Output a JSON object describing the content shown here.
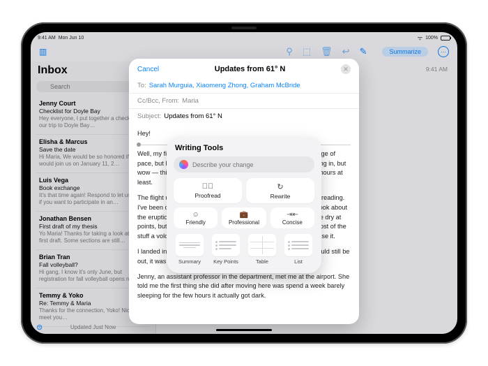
{
  "status": {
    "time": "9:41 AM",
    "date": "Mon Jun 10",
    "battery": "100%"
  },
  "toolbar": {
    "summarize": "Summarize"
  },
  "sidebar": {
    "title": "Inbox",
    "search_placeholder": "Search",
    "updated": "Updated Just Now",
    "items": [
      {
        "from": "Jenny Court",
        "subject": "Checklist for Doyle Bay",
        "preview": "Hey everyone, I put together a checklist for our trip to Doyle Bay…"
      },
      {
        "from": "Elisha & Marcus",
        "subject": "Save the date",
        "preview": "Hi Maria, We would be so honored if you would join us on January 11, 2…"
      },
      {
        "from": "Luis Vega",
        "subject": "Book exchange",
        "preview": "It's that time again! Respond to let us know if you want to participate in an…"
      },
      {
        "from": "Jonathan Bensen",
        "subject": "First draft of my thesis",
        "preview": "Yo Maria! Thanks for taking a look at my first draft. Some sections are still…"
      },
      {
        "from": "Brian Tran",
        "subject": "Fall volleyball?",
        "preview": "Hi gang, I know it's only June, but registration for fall volleyball opens ne…"
      },
      {
        "from": "Temmy & Yoko",
        "subject": "Re: Temmy & Maria",
        "preview": "Thanks for the connection, Yoko! Nice to meet you…"
      }
    ]
  },
  "main": {
    "top_time": "9:41 AM"
  },
  "compose": {
    "cancel": "Cancel",
    "title": "Updates from 61° N",
    "to_label": "To:",
    "to_value": "Sarah Murguia, Xiaomeng Zhong, Graham McBride",
    "cc_label": "Cc/Bcc, From:",
    "cc_value": "Maria",
    "subject_label": "Subject:",
    "subject_value": "Updates from 61° N",
    "body": {
      "greeting": "Hey!",
      "p1": "Well, my first week in Anchorage is in the books. It's a huge change of pace, but I feel so lucky to have landed here. And I knew this going in, but wow — this was the longest week of my life, in terms of daylight hours at least.",
      "p2": "The flight up from Seattle was beautiful. I spent most of the flight reading. I've been on a history kick lately and just finished a pretty solid book about the eruption of Vesuvius and the excavation of Pompeii. It's a little dry at points, but I learned a new word: tephra, which is what we call most of the stuff a volcano actually erupts. Let me know if you find a way to use it.",
      "p3": "I landed in Anchorage around 10pm and the sun looked like it would still be out, it was so trippy to see.",
      "p4": "Jenny, an assistant professor in the department, met me at the airport. She told me the first thing she did after moving here was spend a week barely sleeping for the few hours it actually got dark."
    }
  },
  "writing_tools": {
    "title": "Writing Tools",
    "placeholder": "Describe your change",
    "proofread": "Proofread",
    "rewrite": "Rewrite",
    "friendly": "Friendly",
    "professional": "Professional",
    "concise": "Concise",
    "summary": "Summary",
    "key_points": "Key Points",
    "table": "Table",
    "list": "List"
  }
}
